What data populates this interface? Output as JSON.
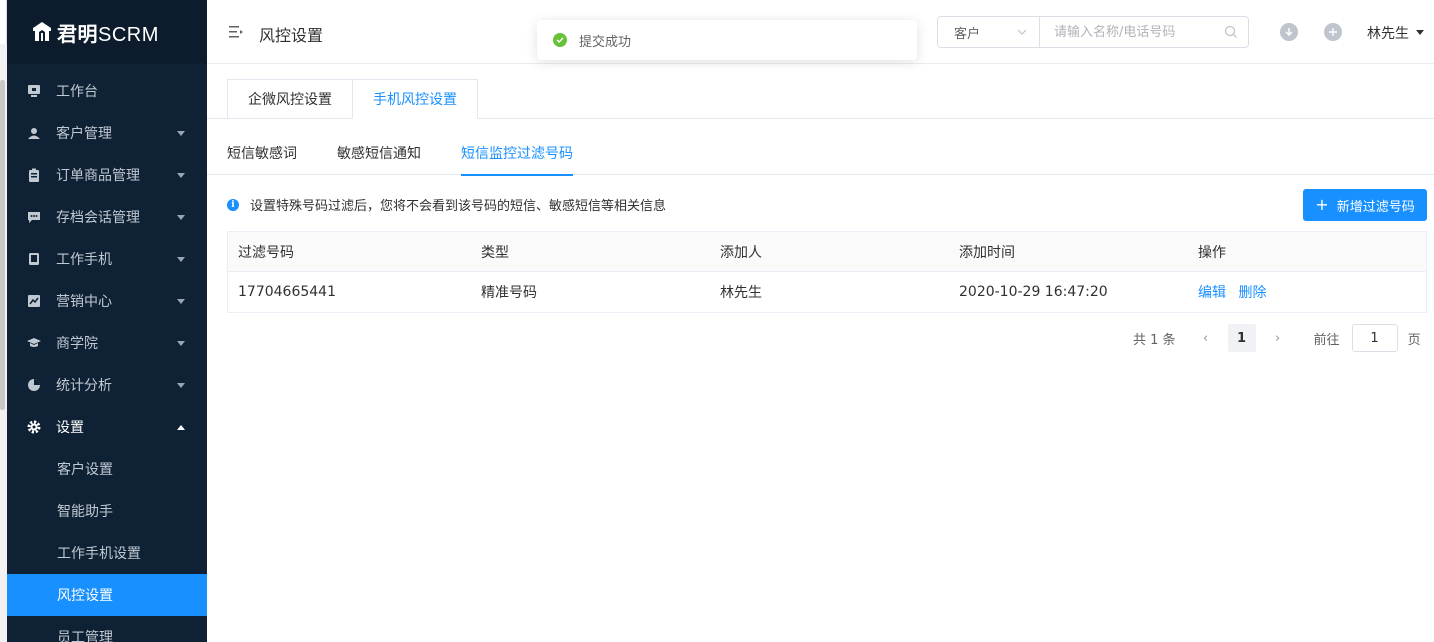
{
  "app": {
    "logo_main": "君明",
    "logo_suffix": "SCRM"
  },
  "sidebar": {
    "items": [
      {
        "label": "工作台",
        "icon": "monitor-icon"
      },
      {
        "label": "客户管理",
        "icon": "customers-icon"
      },
      {
        "label": "订单商品管理",
        "icon": "clipboard-icon"
      },
      {
        "label": "存档会话管理",
        "icon": "chat-icon"
      },
      {
        "label": "工作手机",
        "icon": "phone-icon"
      },
      {
        "label": "营销中心",
        "icon": "chart-icon"
      },
      {
        "label": "商学院",
        "icon": "graduation-icon"
      },
      {
        "label": "统计分析",
        "icon": "pie-icon"
      },
      {
        "label": "设置",
        "icon": "gear-icon"
      }
    ],
    "sub_items": [
      {
        "label": "客户设置"
      },
      {
        "label": "智能助手"
      },
      {
        "label": "工作手机设置"
      },
      {
        "label": "风控设置"
      },
      {
        "label": "员工管理"
      }
    ]
  },
  "header": {
    "title": "风控设置",
    "search_select": "客户",
    "search_placeholder": "请输入名称/电话号码",
    "user_name": "林先生"
  },
  "toast": {
    "text": "提交成功"
  },
  "main": {
    "card_tabs": [
      {
        "label": "企微风控设置"
      },
      {
        "label": "手机风控设置"
      }
    ],
    "sub_tabs": [
      {
        "label": "短信敏感词"
      },
      {
        "label": "敏感短信通知"
      },
      {
        "label": "短信监控过滤号码"
      }
    ],
    "info_text": "设置特殊号码过滤后，您将不会看到该号码的短信、敏感短信等相关信息",
    "add_button": "新增过滤号码",
    "table": {
      "headers": [
        "过滤号码",
        "类型",
        "添加人",
        "添加时间",
        "操作"
      ],
      "rows": [
        {
          "number": "17704665441",
          "type": "精准号码",
          "adder": "林先生",
          "time": "2020-10-29 16:47:20",
          "edit": "编辑",
          "delete": "删除"
        }
      ]
    },
    "pager": {
      "total": "共 1 条",
      "page": "1",
      "goto_label": "前往",
      "goto_value": "1",
      "unit": "页"
    }
  },
  "colors": {
    "primary": "#1890ff",
    "sidebar_bg": "#0f2235",
    "success": "#67c23a"
  }
}
